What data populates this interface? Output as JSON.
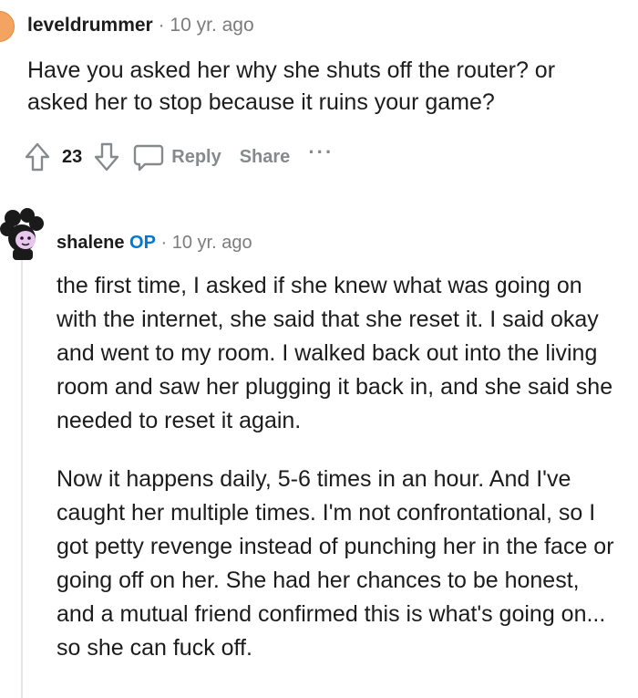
{
  "comment_parent": {
    "username": "leveldrummer",
    "separator": "·",
    "timestamp": "10 yr. ago",
    "text": "Have you asked her why she shuts off the router? or asked her to stop because it ruins your game?",
    "vote_count": "23",
    "reply_label": "Reply",
    "share_label": "Share",
    "more_label": "···"
  },
  "comment_reply": {
    "username": "shalene",
    "op_badge": "OP",
    "separator": "·",
    "timestamp": "10 yr. ago",
    "paragraphs": [
      "the first time, I asked if she knew what was going on with the internet, she said that she reset it. I said okay and went to my room. I walked back out into the living room and saw her plugging it back in, and she said she needed to reset it again.",
      "Now it happens daily, 5-6 times in an hour. And I've caught her multiple times. I'm not confrontational, so I got petty revenge instead of punching her in the face or going off on her. She had her chances to be honest, and a mutual friend confirmed this is what's going on... so she can fuck off."
    ]
  },
  "colors": {
    "meta_gray": "#7c7c7c",
    "action_gray": "#878a8c",
    "op_blue": "#0079d3",
    "text": "#1c1c1c"
  }
}
